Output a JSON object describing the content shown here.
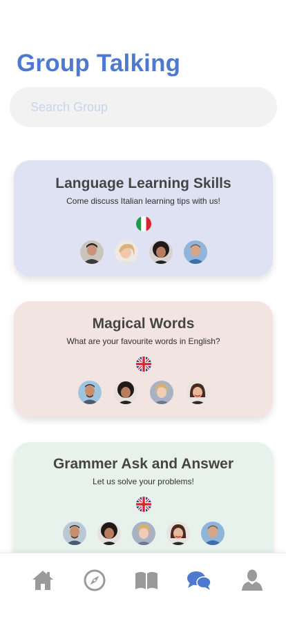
{
  "header": {
    "title": "Group Talking"
  },
  "search": {
    "placeholder": "Search Group",
    "value": ""
  },
  "groups": [
    {
      "title": "Language Learning Skills",
      "description": "Come discuss Italian learning tips with us!",
      "flag_icon": "italy-flag-icon",
      "member_count_shown": 4
    },
    {
      "title": "Magical Words",
      "description": "What are your favourite words in English?",
      "flag_icon": "uk-flag-icon",
      "member_count_shown": 4
    },
    {
      "title": "Grammer Ask and Answer",
      "description": "Let us solve your problems!",
      "flag_icon": "uk-flag-icon",
      "member_count_shown": 5
    }
  ],
  "tabbar": {
    "items": [
      {
        "icon": "home-icon",
        "active": false
      },
      {
        "icon": "compass-icon",
        "active": false
      },
      {
        "icon": "book-icon",
        "active": false
      },
      {
        "icon": "chat-bubbles-icon",
        "active": true
      },
      {
        "icon": "profile-icon",
        "active": false
      }
    ]
  },
  "colors": {
    "accent": "#4e79d1",
    "inactive_icon": "#9a9a9a",
    "card_1_bg": "#dee2f3",
    "card_2_bg": "#f2e4e0",
    "card_3_bg": "#e8f2ec",
    "search_bg": "#f2f2f2"
  }
}
